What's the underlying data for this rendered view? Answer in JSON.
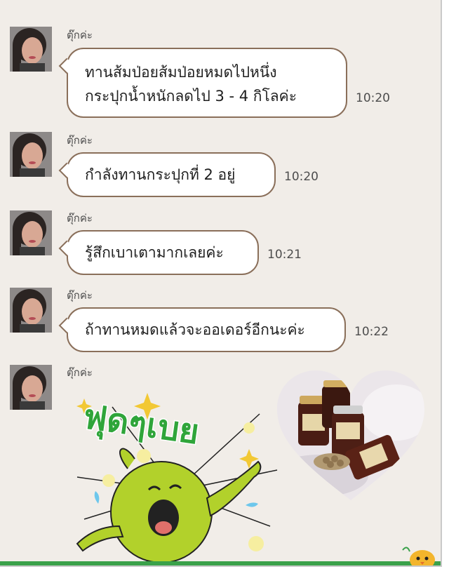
{
  "chat": {
    "messages": [
      {
        "sender": "ตุ๊กค่ะ",
        "lines": [
          "ทานส้มป่อยส้มป่อยหมดไปหนึ่ง",
          "กระปุกน้ำหนักลดไป 3 - 4 กิโลค่ะ"
        ],
        "time": "10:20"
      },
      {
        "sender": "ตุ๊กค่ะ",
        "lines": [
          "กำลังทานกระปุกที่ 2 อยู่"
        ],
        "time": "10:20"
      },
      {
        "sender": "ตุ๊กค่ะ",
        "lines": [
          "รู้สึกเบาเตามากเลยค่ะ"
        ],
        "time": "10:21"
      },
      {
        "sender": "ตุ๊กค่ะ",
        "lines": [
          "ถ้าทานหมดแล้วจะออเดอร์อีกนะค่ะ"
        ],
        "time": "10:22"
      },
      {
        "sender": "ตุ๊กค่ะ"
      }
    ],
    "sticker": {
      "text": "ฟุดๆเบย"
    }
  },
  "colors": {
    "background": "#f1ede8",
    "bubble_border": "#8a6f5a",
    "sticker_green": "#2fa53a",
    "ground": "#3aa14a"
  }
}
